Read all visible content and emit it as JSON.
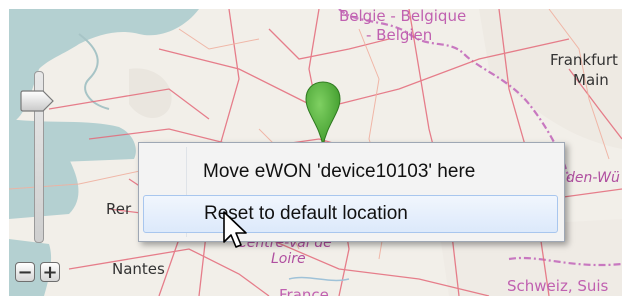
{
  "map": {
    "labels": {
      "belgium": "Belgie - Belgique",
      "belgium_de": "- Belgien",
      "frankfurt": "Frankfurt",
      "main": "Main",
      "rennes": "Rer",
      "nantes": "Nantes",
      "centre": "Centre-Val de",
      "loire": "Loire",
      "baden": "den-Wü",
      "switzerland": "Schweiz, Suis",
      "france": "France"
    }
  },
  "zoom": {
    "out_label": "−",
    "in_label": "+",
    "level": 0.88
  },
  "context_menu": {
    "items": [
      {
        "label": "Move eWON 'device10103' here",
        "highlighted": false
      },
      {
        "label": "Reset to default location",
        "highlighted": true
      }
    ]
  },
  "colors": {
    "marker": "#4caf37",
    "menu_highlight_border": "#a8c6ee"
  },
  "icons": {
    "marker": "map-pin-icon",
    "cursor": "mouse-pointer-icon"
  }
}
